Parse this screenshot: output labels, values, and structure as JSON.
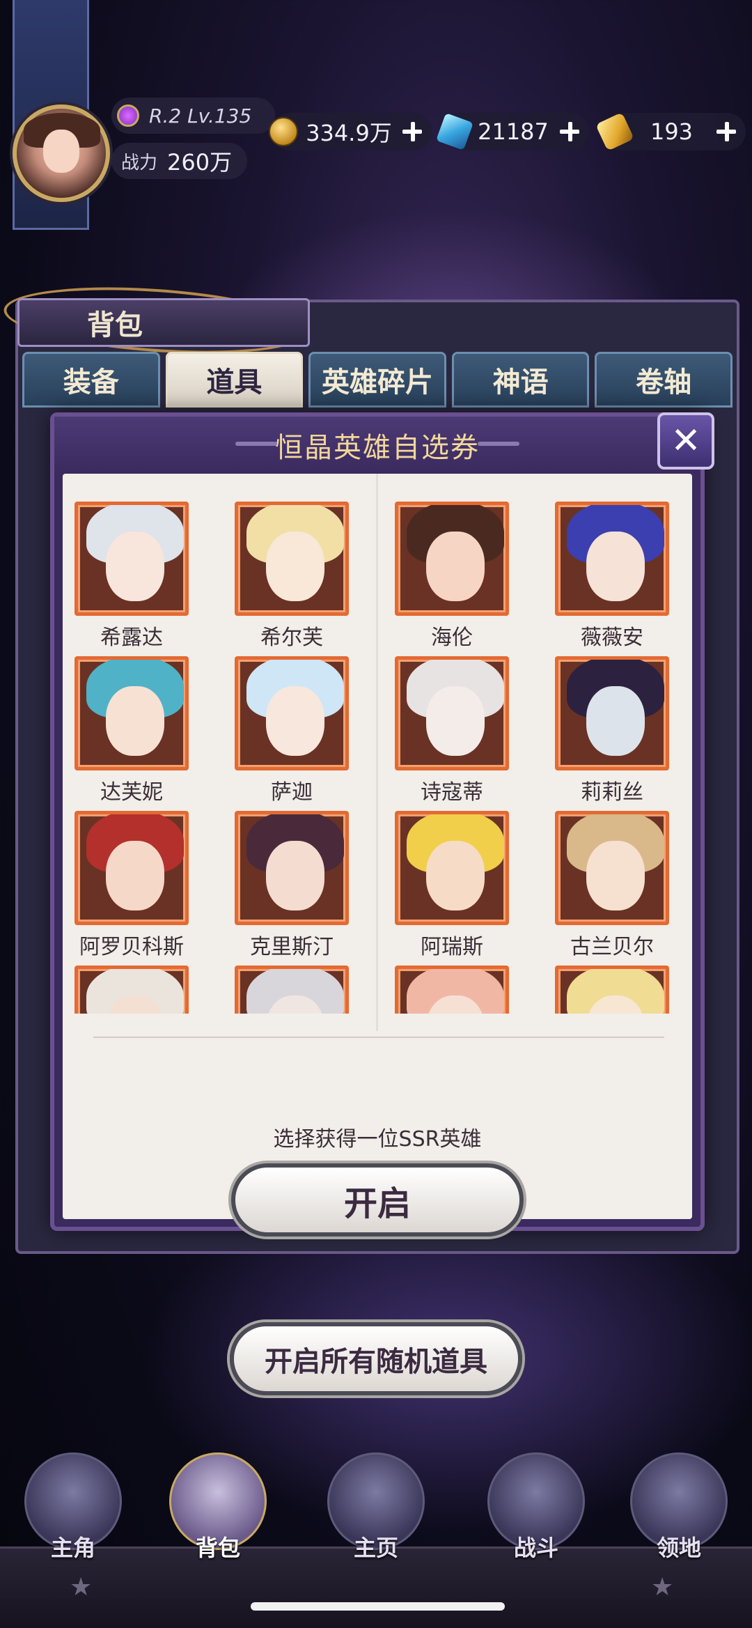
{
  "hud": {
    "level_text": "R.2 Lv.135",
    "power_label": "战力",
    "power_value": "260万",
    "resources": [
      {
        "icon": "gold-coin-icon",
        "value": "334.9万"
      },
      {
        "icon": "blue-crystal-icon",
        "value": "21187"
      },
      {
        "icon": "gold-gem-icon",
        "value": "193"
      }
    ]
  },
  "backpack": {
    "title": "背包",
    "tabs": [
      {
        "label": "装备",
        "active": false
      },
      {
        "label": "道具",
        "active": true
      },
      {
        "label": "英雄碎片",
        "active": false
      },
      {
        "label": "神语",
        "active": false
      },
      {
        "label": "卷轴",
        "active": false
      }
    ]
  },
  "modal": {
    "title": "恒晶英雄自选券",
    "close_icon": "close-x-icon",
    "heroes": [
      {
        "name": "希露达",
        "hair": "#dfe3ea",
        "face": "#f8e6dc"
      },
      {
        "name": "希尔芙",
        "hair": "#f1dfa6",
        "face": "#f9e7d8"
      },
      {
        "name": "海伦",
        "hair": "#4a2a20",
        "face": "#f7d5c4"
      },
      {
        "name": "薇薇安",
        "hair": "#3b3fb0",
        "face": "#f6e2d6"
      },
      {
        "name": "达芙妮",
        "hair": "#4fb2c6",
        "face": "#f7e1d3"
      },
      {
        "name": "萨迦",
        "hair": "#cfe6f6",
        "face": "#f8e7dc"
      },
      {
        "name": "诗寇蒂",
        "hair": "#e7e3e3",
        "face": "#f3ece8"
      },
      {
        "name": "莉莉丝",
        "hair": "#2c2240",
        "face": "#dde3ea"
      },
      {
        "name": "阿罗贝科斯",
        "hair": "#b3302c",
        "face": "#f6d8c8"
      },
      {
        "name": "克里斯汀",
        "hair": "#4a2a3a",
        "face": "#f4ddd0"
      },
      {
        "name": "阿瑞斯",
        "hair": "#f1cf4a",
        "face": "#f6dcc6"
      },
      {
        "name": "古兰贝尔",
        "hair": "#d9b98a",
        "face": "#f6e0d0"
      },
      {
        "name": "",
        "hair": "#eae4dd",
        "face": "#f3e0d2"
      },
      {
        "name": "",
        "hair": "#d8d6da",
        "face": "#efe6e2"
      },
      {
        "name": "",
        "hair": "#f1b7a5",
        "face": "#f6e0d4"
      },
      {
        "name": "",
        "hair": "#f0dc92",
        "face": "#f7e6d2"
      }
    ],
    "hint": "选择获得一位SSR英雄",
    "open_label": "开启"
  },
  "open_all_label": "开启所有随机道具",
  "nav": [
    {
      "label": "主角",
      "icon": "hero-icon",
      "active": false
    },
    {
      "label": "背包",
      "icon": "backpack-icon",
      "active": true
    },
    {
      "label": "主页",
      "icon": "book-icon",
      "active": false
    },
    {
      "label": "战斗",
      "icon": "swords-icon",
      "active": false
    },
    {
      "label": "领地",
      "icon": "castle-icon",
      "active": false
    }
  ]
}
